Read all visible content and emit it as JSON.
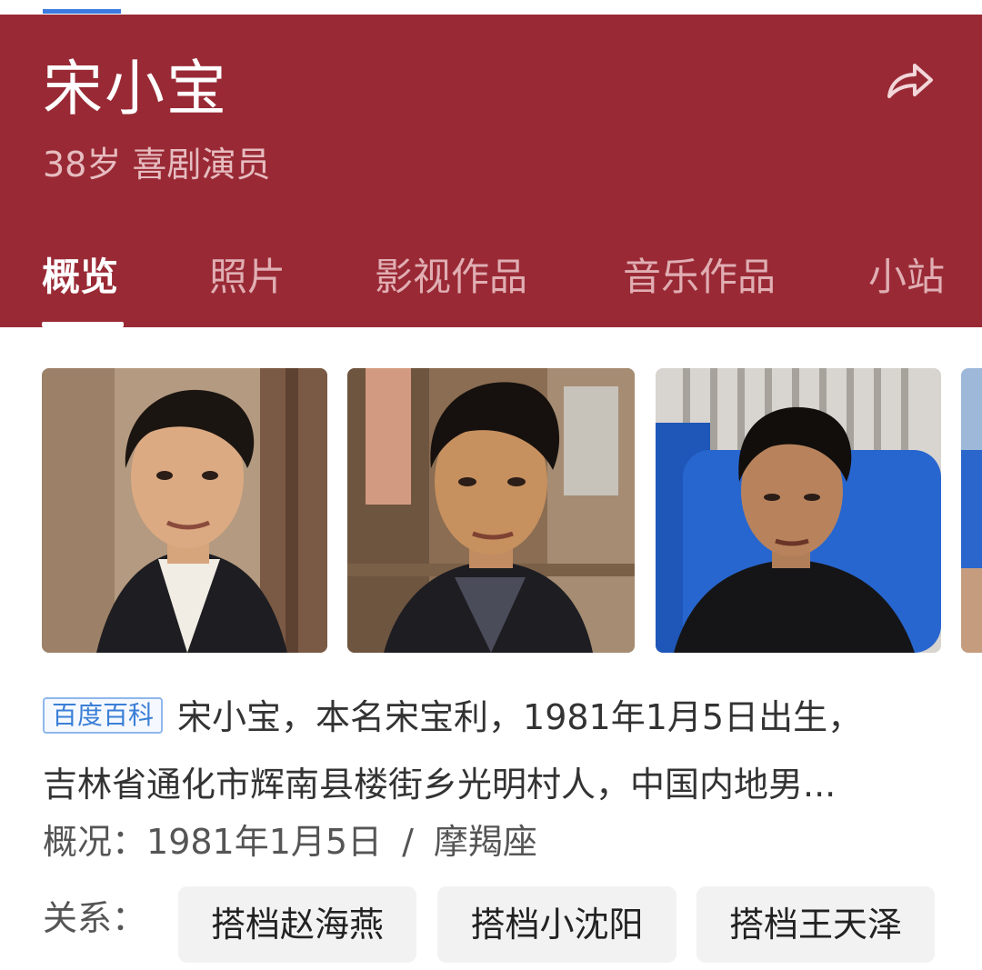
{
  "header": {
    "name": "宋小宝",
    "subtitle": "38岁 喜剧演员",
    "share_icon": "share-arrow-icon"
  },
  "tabs": [
    "概览",
    "照片",
    "影视作品",
    "音乐作品",
    "小站"
  ],
  "active_tab": "概览",
  "photos": [
    "photo-1",
    "photo-2",
    "photo-3",
    "photo-4"
  ],
  "summary": {
    "badge": "百度百科",
    "line1": "宋小宝，本名宋宝利，1981年1月5日出生，",
    "line2": "吉林省通化市辉南县楼街乡光明村人，中国内地男..."
  },
  "overview": {
    "label": "概况：",
    "birth": "1981年1月5日",
    "separator": "/",
    "zodiac": "摩羯座"
  },
  "relations": {
    "label": "关系：",
    "items": [
      "搭档赵海燕",
      "搭档小沈阳",
      "搭档王天泽"
    ]
  },
  "colors": {
    "header_bg": "#992a35",
    "tab_active": "#ffffff",
    "badge_blue": "#3b7fd6",
    "indicator_blue": "#3e7be0"
  }
}
